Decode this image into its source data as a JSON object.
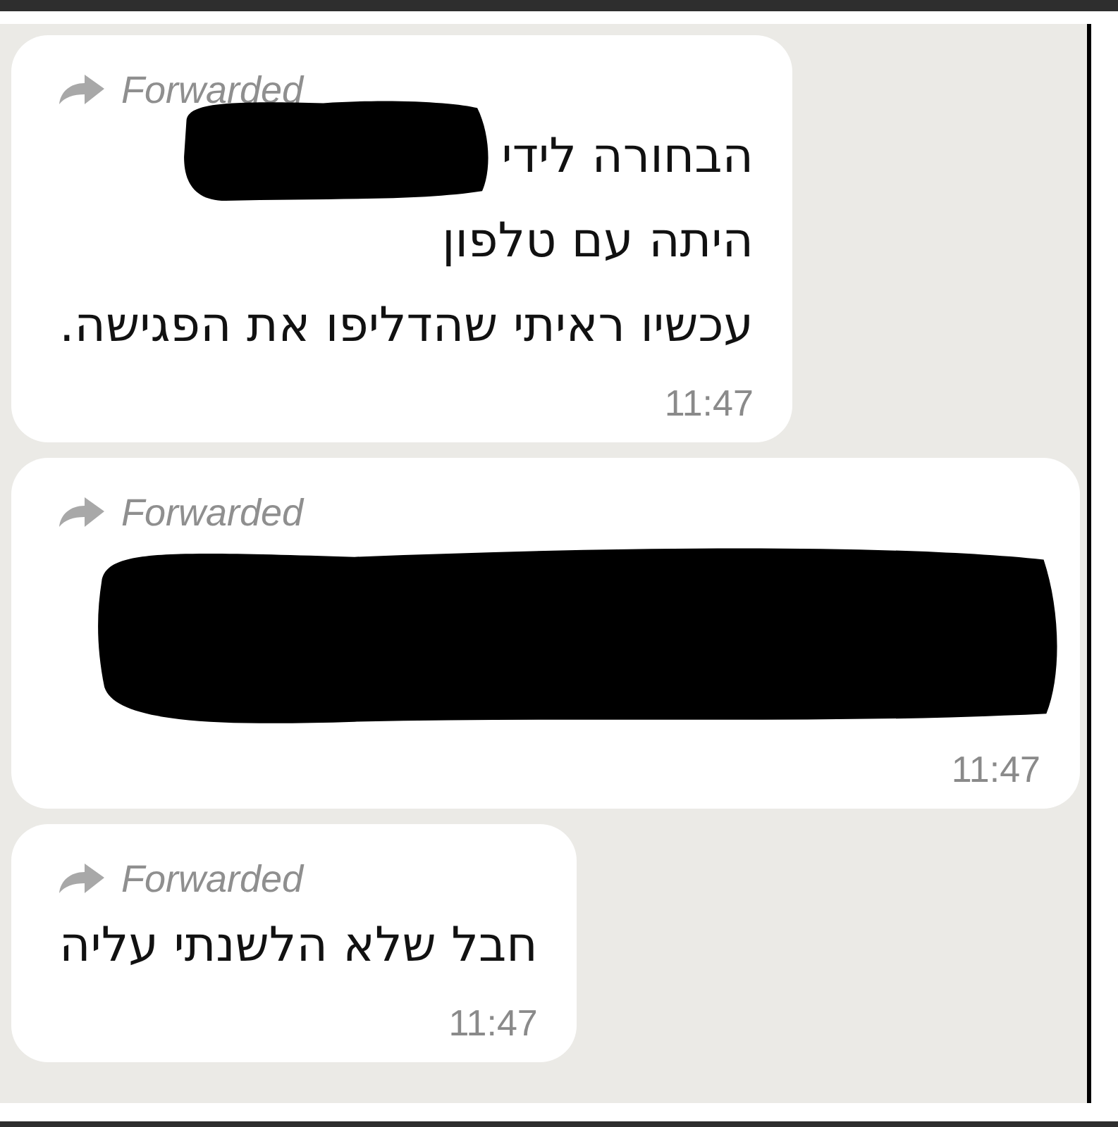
{
  "messages": [
    {
      "forwarded_label": "Forwarded",
      "lines": [
        {
          "kind": "text_redacted",
          "text": "הבחורה לידי"
        },
        {
          "kind": "text",
          "text": "היתה עם טלפון"
        },
        {
          "kind": "text",
          "text": "עכשיו ראיתי שהדליפו את הפגישה."
        }
      ],
      "time": "11:47"
    },
    {
      "forwarded_label": "Forwarded",
      "lines": [
        {
          "kind": "redaction"
        }
      ],
      "time": "11:47"
    },
    {
      "forwarded_label": "Forwarded",
      "lines": [
        {
          "kind": "text",
          "text": "חבל שלא הלשנתי עליה"
        }
      ],
      "time": "11:47"
    }
  ]
}
